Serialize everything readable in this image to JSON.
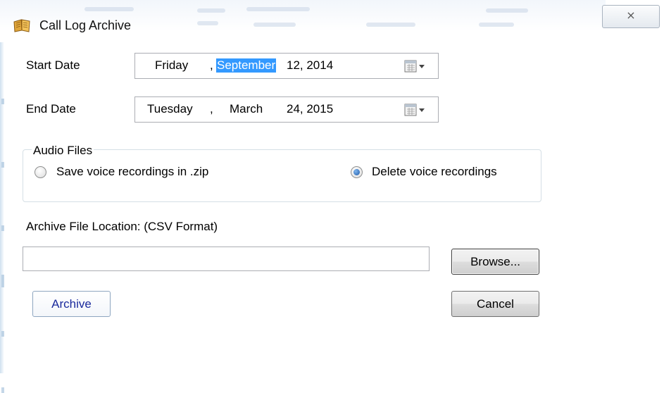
{
  "window": {
    "title": "Call Log Archive",
    "close_glyph": "⨯"
  },
  "start_date": {
    "label": "Start Date",
    "weekday": "Friday",
    "sep1": ",",
    "month": "September",
    "day_year": "12, 2014"
  },
  "end_date": {
    "label": "End Date",
    "weekday": "Tuesday",
    "sep1": ",",
    "month": "March",
    "day_year": "24, 2015"
  },
  "audio_files": {
    "legend": "Audio Files",
    "options": [
      {
        "label": "Save voice recordings in .zip",
        "checked": false
      },
      {
        "label": "Delete voice recordings",
        "checked": true
      }
    ]
  },
  "archive_location": {
    "label": "Archive File Location: (CSV Format)",
    "value": "",
    "browse_label": "Browse..."
  },
  "buttons": {
    "archive": "Archive",
    "cancel": "Cancel"
  },
  "colors": {
    "selection": "#3399ff",
    "archive_text": "#1a2a9c"
  },
  "icons": {
    "app": "book-icon",
    "calendar": "calendar-dropdown-icon"
  }
}
